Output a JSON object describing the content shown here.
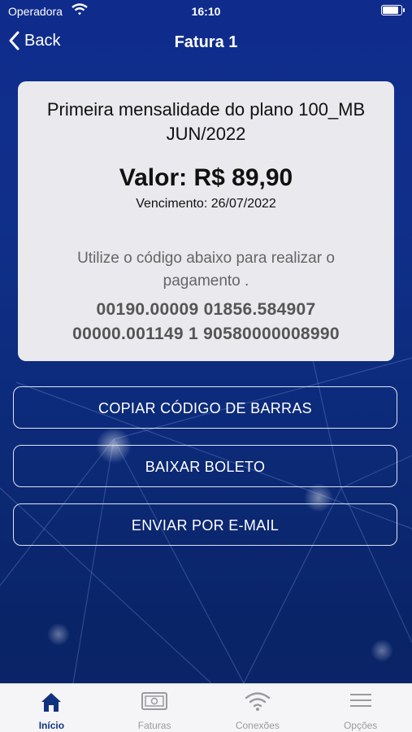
{
  "status": {
    "carrier": "Operadora",
    "time": "16:10",
    "battery_level": 1.0
  },
  "nav": {
    "back_label": "Back",
    "title": "Fatura 1"
  },
  "invoice": {
    "description_line1": "Primeira mensalidade do plano 100_MB",
    "description_line2": "JUN/2022",
    "valor": "Valor: R$ 89,90",
    "vencimento": "Vencimento: 26/07/2022",
    "instruction": "Utilize o código abaixo para realizar o pagamento .",
    "barcode_line1": "00190.00009 01856.584907",
    "barcode_line2": "00000.001149 1 90580000008990"
  },
  "actions": {
    "copy_label": "COPIAR CÓDIGO DE BARRAS",
    "download_label": "BAIXAR BOLETO",
    "email_label": "ENVIAR POR E-MAIL"
  },
  "tabs": [
    {
      "label": "Início",
      "icon": "home-icon",
      "active": true
    },
    {
      "label": "Faturas",
      "icon": "bill-icon",
      "active": false
    },
    {
      "label": "Conexões",
      "icon": "wifi-icon",
      "active": false
    },
    {
      "label": "Opções",
      "icon": "menu-icon",
      "active": false
    }
  ],
  "colors": {
    "accent": "#11337f",
    "background": "#0f2c8c",
    "card": "#e9e9ee",
    "tab_inactive": "#9a9aa0"
  }
}
